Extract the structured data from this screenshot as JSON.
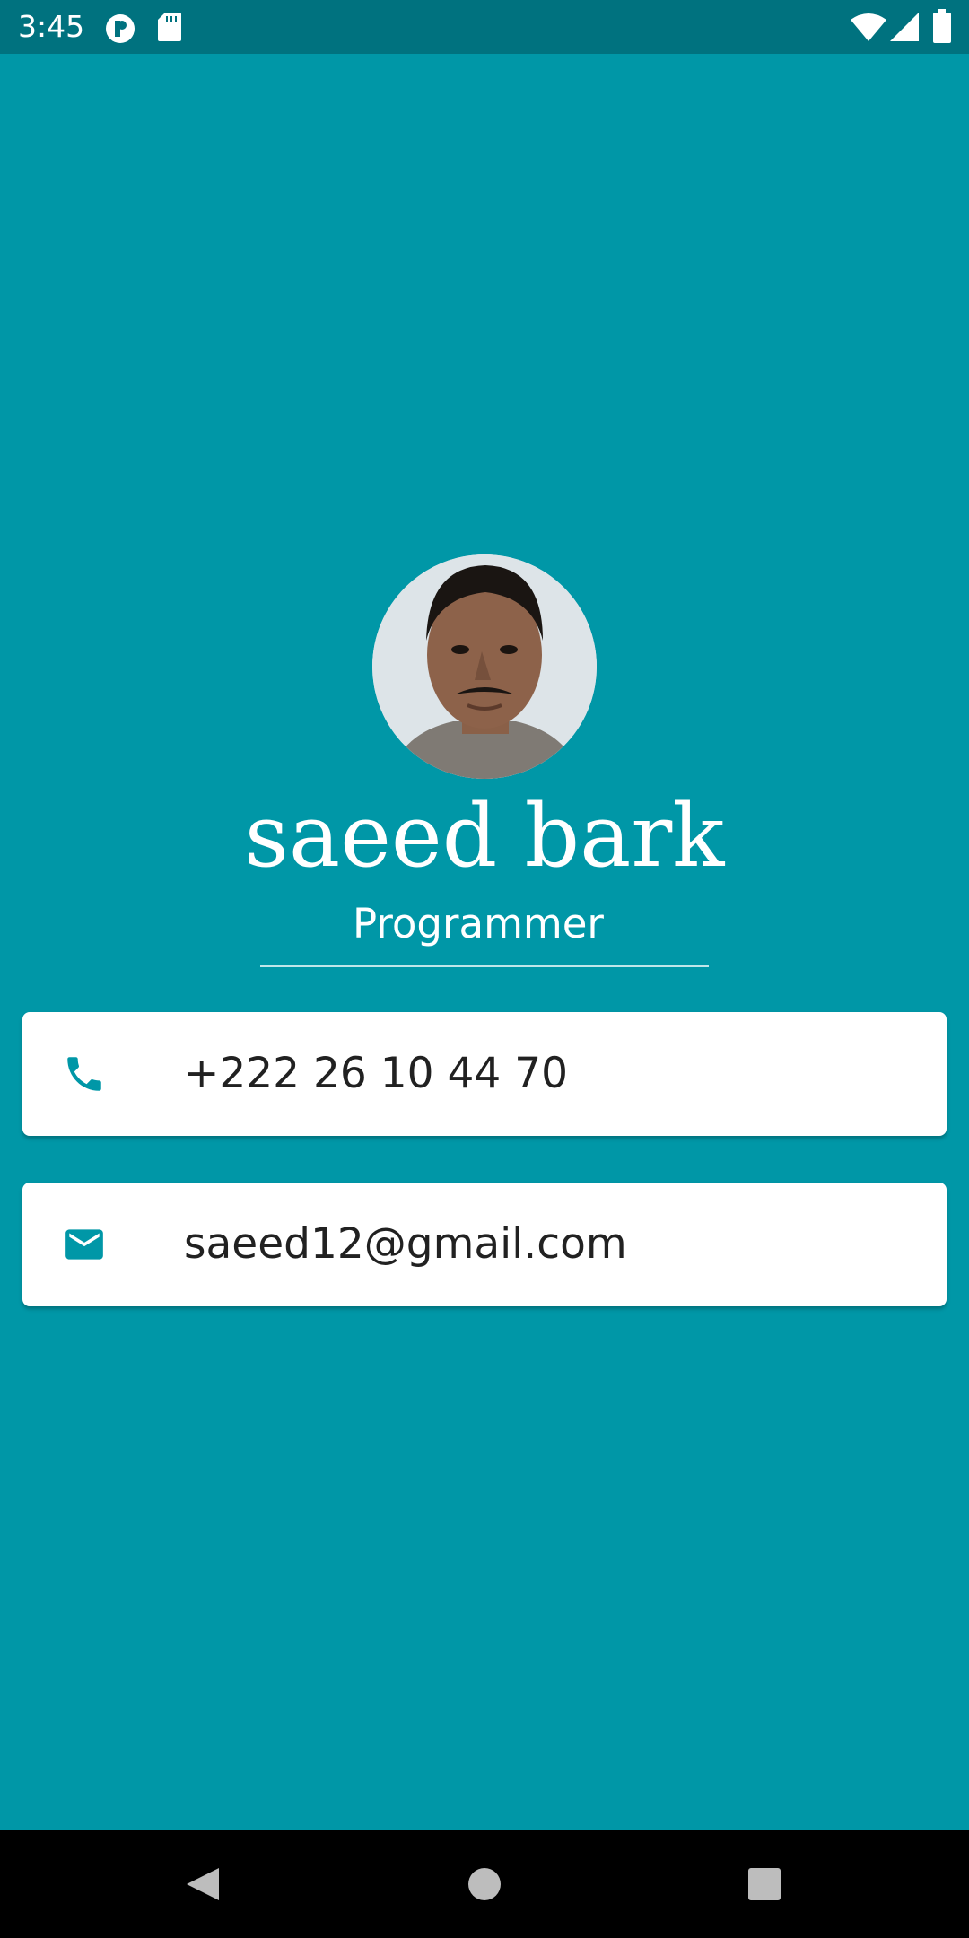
{
  "status_bar": {
    "time": "3:45",
    "icons": [
      "privacy-indicator-icon",
      "sd-card-icon",
      "wifi-icon",
      "cell-signal-icon",
      "battery-icon"
    ],
    "background": "#00727f"
  },
  "profile": {
    "name": "saeed bark",
    "title": "Programmer",
    "avatar": "profile-photo"
  },
  "contacts": [
    {
      "icon": "phone-icon",
      "value": "+222 26 10 44 70"
    },
    {
      "icon": "mail-icon",
      "value": "saeed12@gmail.com"
    }
  ],
  "nav_bar": {
    "buttons": [
      "back-icon",
      "home-icon",
      "recents-icon"
    ]
  },
  "colors": {
    "background": "#0097a7",
    "card": "#ffffff",
    "accent": "#0097a7",
    "text": "#212121"
  }
}
